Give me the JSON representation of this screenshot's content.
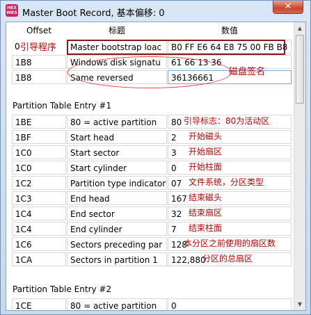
{
  "window": {
    "title": "Master Boot Record, 基本偏移: 0",
    "logo_text": "HEX\nWORKS",
    "close_label": "✕"
  },
  "columns": {
    "offset": "Offset",
    "title": "标题",
    "value": "数值"
  },
  "mbr_rows": [
    {
      "offset": "0",
      "title": "Master bootstrap loac",
      "value": "B0 FF E6 64 E8 75 00 FB B8 00"
    },
    {
      "offset": "1B8",
      "title": "Windows disk signatu",
      "value": "61 66 13 36"
    },
    {
      "offset": "1B8",
      "title": "Same reversed",
      "value": "36136661"
    }
  ],
  "section1": {
    "label": "Partition Table Entry #1",
    "rows": [
      {
        "offset": "1BE",
        "title": "80 = active partition",
        "value": "80"
      },
      {
        "offset": "1BF",
        "title": "Start head",
        "value": "2"
      },
      {
        "offset": "1C0",
        "title": "Start sector",
        "value": "3"
      },
      {
        "offset": "1C0",
        "title": "Start cylinder",
        "value": "0"
      },
      {
        "offset": "1C2",
        "title": "Partition type indicator",
        "value": "07"
      },
      {
        "offset": "1C3",
        "title": "End head",
        "value": "167"
      },
      {
        "offset": "1C4",
        "title": "End sector",
        "value": "32"
      },
      {
        "offset": "1C4",
        "title": "End cylinder",
        "value": "7"
      },
      {
        "offset": "1C6",
        "title": "Sectors preceding par",
        "value": "128"
      },
      {
        "offset": "1CA",
        "title": "Sectors in partition 1",
        "value": "122,880"
      }
    ]
  },
  "section2": {
    "label": "Partition Table Entry #2",
    "rows": [
      {
        "offset": "1CE",
        "title": "80 = active partition",
        "value": "0"
      }
    ]
  },
  "annotations": {
    "boot_code": "引导程序",
    "disk_signature": "磁盘签名",
    "boot_flag": "引导标志：80为活动区",
    "start_head": "开始磁头",
    "start_sector": "开始扇区",
    "start_cylinder": "开始柱面",
    "fs_type": "文件系统，分区类型",
    "end_head": "结束磁头",
    "end_sector": "结束扇区",
    "end_cylinder": "结束柱面",
    "sectors_before": "本分区之前使用的扇区数",
    "total_sectors": "分区的总扇区"
  },
  "colors": {
    "annotation": "#c00000",
    "highlight_box": "#8b1a1a",
    "ellipse": "#e04040"
  }
}
